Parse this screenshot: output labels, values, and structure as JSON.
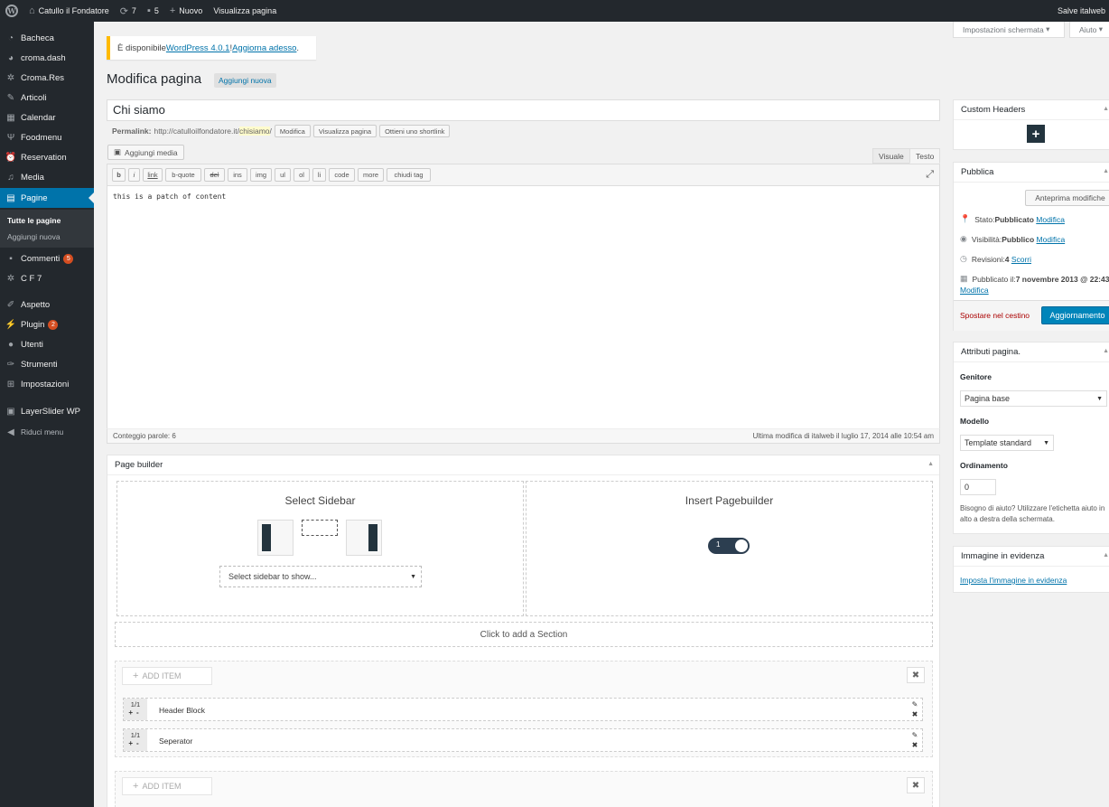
{
  "adminbar": {
    "site_name": "Catullo il Fondatore",
    "updates_count": "7",
    "comments_count": "5",
    "new_label": "Nuovo",
    "view_page": "Visualizza pagina",
    "greeting": "Salve italweb"
  },
  "menu": {
    "items": [
      {
        "label": "Bacheca",
        "icon": "dashboard-icon"
      },
      {
        "label": "croma.dash",
        "icon": "croma-icon"
      },
      {
        "label": "Croma.Res",
        "icon": "gear-icon"
      },
      {
        "label": "Articoli",
        "icon": "pin-icon"
      },
      {
        "label": "Calendar",
        "icon": "calendar-icon"
      },
      {
        "label": "Foodmenu",
        "icon": "fork-knife-icon"
      },
      {
        "label": "Reservation",
        "icon": "alarm-icon"
      },
      {
        "label": "Media",
        "icon": "media-icon"
      },
      {
        "label": "Pagine",
        "icon": "page-icon"
      },
      {
        "label": "Commenti",
        "icon": "comment-icon",
        "badge": "5"
      },
      {
        "label": "C F 7",
        "icon": "gear-icon"
      },
      {
        "label": "Aspetto",
        "icon": "brush-icon"
      },
      {
        "label": "Plugin",
        "icon": "plugin-icon",
        "badge": "2"
      },
      {
        "label": "Utenti",
        "icon": "user-icon"
      },
      {
        "label": "Strumenti",
        "icon": "wrench-icon"
      },
      {
        "label": "Impostazioni",
        "icon": "settings-icon"
      },
      {
        "label": "LayerSlider WP",
        "icon": "layers-icon"
      },
      {
        "label": "Riduci menu",
        "icon": "collapse-icon"
      }
    ],
    "submenu": [
      "Tutte le pagine",
      "Aggiungi nuova"
    ]
  },
  "screen_options": "Impostazioni schermata",
  "help": "Aiuto",
  "notice": {
    "prefix": "È disponibile ",
    "link1": "WordPress 4.0.1",
    "sep": "! ",
    "link2": "Aggiorna adesso",
    "suffix": "."
  },
  "page_title": "Modifica pagina",
  "add_new": "Aggiungi nuova",
  "post_title": "Chi siamo",
  "permalink": {
    "label": "Permalink:",
    "base": "http://catulloilfondatore.it/",
    "slug": "chisiamo",
    "tail": "/",
    "btn_edit": "Modifica",
    "btn_view": "Visualizza pagina",
    "btn_short": "Ottieni uno shortlink"
  },
  "editor": {
    "add_media": "Aggiungi media",
    "tab_visual": "Visuale",
    "tab_text": "Testo",
    "quicktags": [
      "b",
      "i",
      "link",
      "b-quote",
      "del",
      "ins",
      "img",
      "ul",
      "ol",
      "li",
      "code",
      "more",
      "chiudi tag"
    ],
    "content": "this is a patch of content",
    "word_count": "Conteggio parole: 6",
    "last_edit": "Ultima modifica di italweb il luglio 17, 2014 alle 10:54 am"
  },
  "page_builder": {
    "title": "Page builder",
    "select_sidebar": "Select Sidebar",
    "sidebar_placeholder": "Select sidebar to show...",
    "insert_pagebuilder": "Insert Pagebuilder",
    "toggle_value": "1",
    "add_section": "Click to add a Section",
    "add_item": "ADD ITEM",
    "blocks": [
      {
        "size": "1/1",
        "label": "Header Block"
      },
      {
        "size": "1/1",
        "label": "Seperator"
      }
    ]
  },
  "custom_headers": {
    "title": "Custom Headers"
  },
  "publish": {
    "title": "Pubblica",
    "preview": "Anteprima modifiche",
    "status_label": "Stato: ",
    "status_value": "Pubblicato",
    "status_edit": "Modifica",
    "visibility_label": "Visibilità: ",
    "visibility_value": "Pubblico",
    "visibility_edit": "Modifica",
    "revisions_label": "Revisioni: ",
    "revisions_value": "4",
    "revisions_link": "Scorri",
    "published_label": "Pubblicato il: ",
    "published_value": "7 novembre 2013 @ 22:43",
    "published_edit": "Modifica",
    "trash": "Spostare nel cestino",
    "update": "Aggiornamento"
  },
  "attributes": {
    "title": "Attributi pagina.",
    "parent_label": "Genitore",
    "parent_value": "Pagina base",
    "template_label": "Modello",
    "template_value": "Template standard",
    "order_label": "Ordinamento",
    "order_value": "0",
    "help": "Bisogno di aiuto? Utilizzare l'etichetta aiuto in alto a destra della schermata."
  },
  "featured": {
    "title": "Immagine in evidenza",
    "link": "Imposta l'immagine in evidenza"
  },
  "colors": {
    "admin_dark": "#23282d",
    "accent": "#0073aa",
    "primary_button": "#0085ba",
    "badge": "#d54e21",
    "notice": "#ffba00"
  }
}
